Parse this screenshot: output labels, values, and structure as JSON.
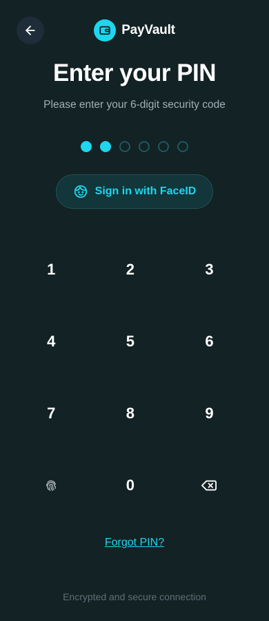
{
  "header": {
    "brand_name": "PayVault",
    "back_icon": "arrow-left-icon",
    "logo_icon": "wallet-icon"
  },
  "title": "Enter your PIN",
  "subtitle": "Please enter your 6-digit security code",
  "pin": {
    "length": 6,
    "filled": 2
  },
  "faceid": {
    "label": "Sign in with FaceID",
    "icon": "face-icon"
  },
  "keypad": {
    "keys": [
      "1",
      "2",
      "3",
      "4",
      "5",
      "6",
      "7",
      "8",
      "9",
      "0"
    ],
    "fingerprint_icon": "fingerprint-icon",
    "backspace_icon": "backspace-icon"
  },
  "forgot_label": "Forgot PIN?",
  "footer_text": "Encrypted and secure connection",
  "colors": {
    "background": "#132224",
    "accent": "#1ed6ee",
    "text_primary": "#ffffff",
    "text_secondary": "#a3b0b8",
    "text_muted": "#5e6f78"
  }
}
